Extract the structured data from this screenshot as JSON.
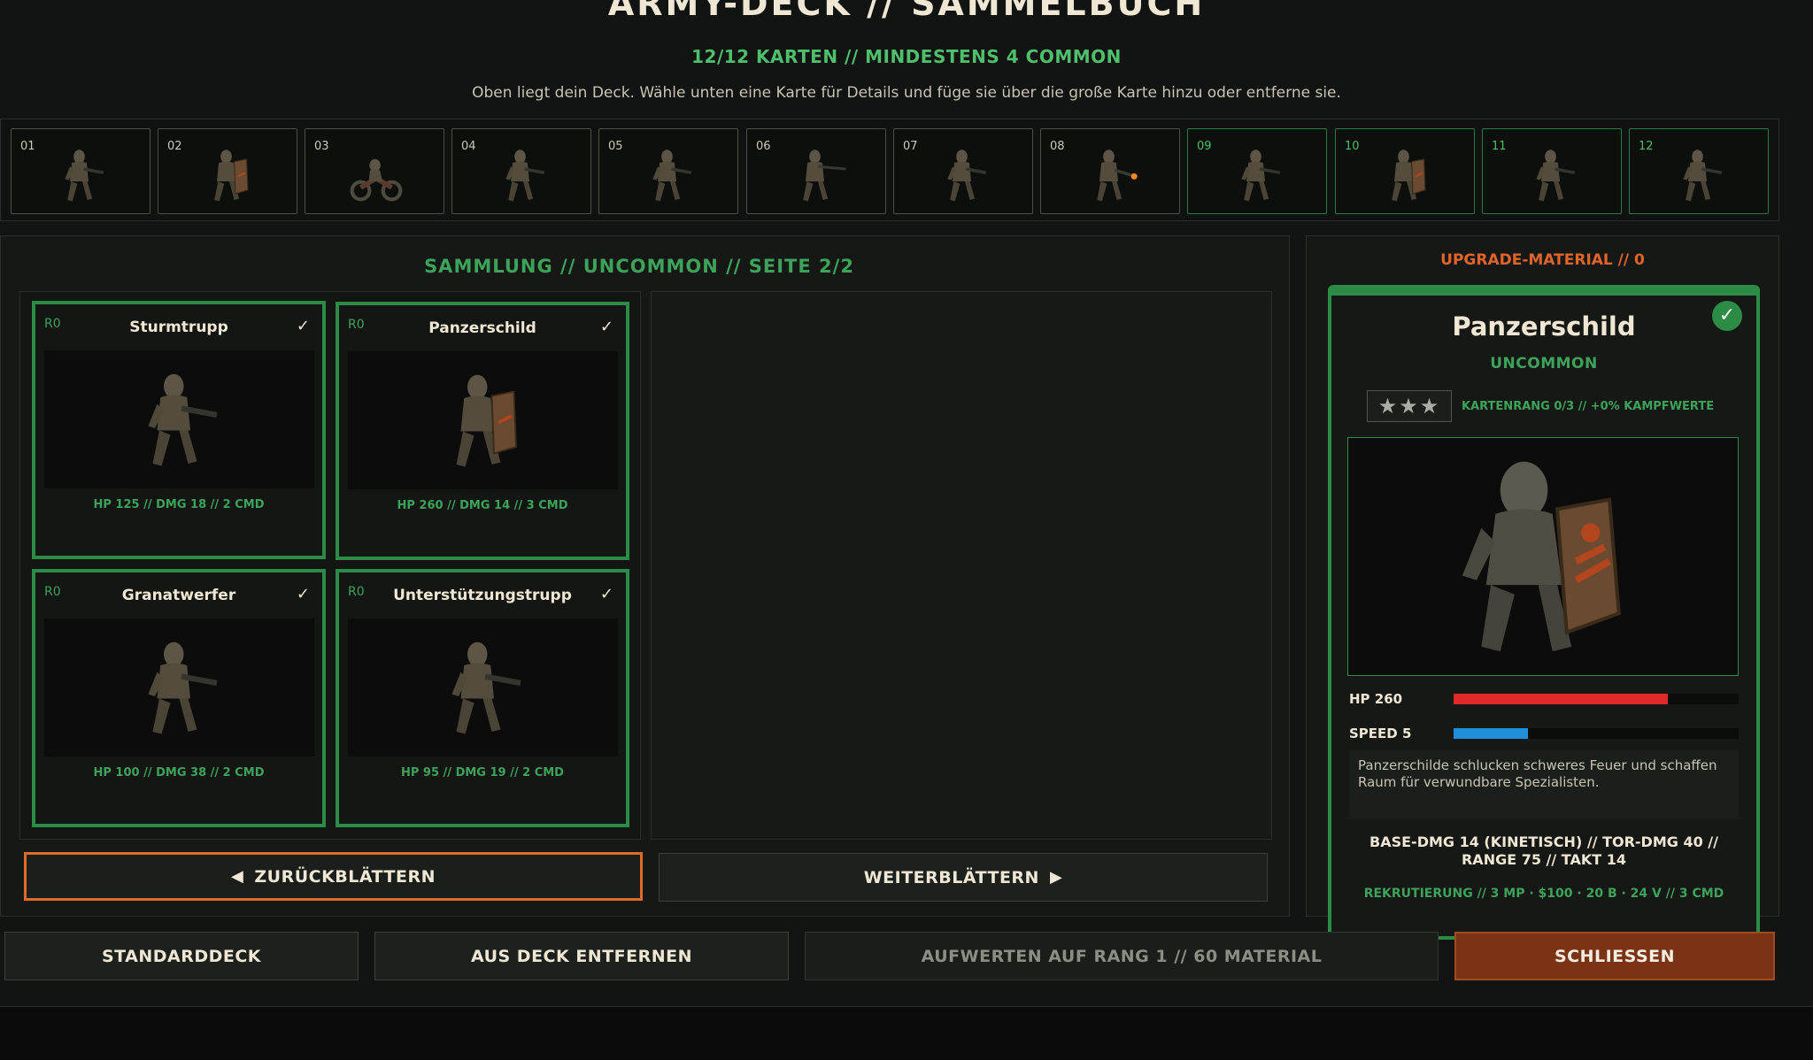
{
  "header": {
    "title": "ARMY-DECK  //  SAMMELBUCH",
    "subtitle": "12/12 KARTEN  //  MINDESTENS 4 COMMON",
    "hint": "Oben liegt dein Deck. Wähle unten eine Karte für Details und füge sie über die große Karte hinzu oder entferne sie."
  },
  "deck": {
    "slots": [
      {
        "num": "01",
        "unit": "rifle-soldier-icon"
      },
      {
        "num": "02",
        "unit": "shield-soldier-icon"
      },
      {
        "num": "03",
        "unit": "motorbike-icon"
      },
      {
        "num": "04",
        "unit": "rifle-soldier-icon"
      },
      {
        "num": "05",
        "unit": "rifle-soldier-icon"
      },
      {
        "num": "06",
        "unit": "sniper-icon"
      },
      {
        "num": "07",
        "unit": "scout-icon"
      },
      {
        "num": "08",
        "unit": "flamethrower-icon"
      },
      {
        "num": "09",
        "unit": "grenadier-icon"
      },
      {
        "num": "10",
        "unit": "shield-soldier-icon"
      },
      {
        "num": "11",
        "unit": "grenadier-icon"
      },
      {
        "num": "12",
        "unit": "support-gunner-icon"
      }
    ]
  },
  "collection": {
    "title": "SAMMLUNG  //  UNCOMMON  //  SEITE 2/2",
    "cards": [
      {
        "rank": "R0",
        "name": "Sturmtrupp",
        "check": "✓",
        "stats": "HP 125  //  DMG 18  //  2 CMD",
        "selected": false
      },
      {
        "rank": "R0",
        "name": "Panzerschild",
        "check": "✓",
        "stats": "HP 260  //  DMG 14  //  3 CMD",
        "selected": true
      },
      {
        "rank": "R0",
        "name": "Granatwerfer",
        "check": "✓",
        "stats": "HP 100  //  DMG 38  //  2 CMD",
        "selected": false
      },
      {
        "rank": "R0",
        "name": "Unterstützungstrupp",
        "check": "✓",
        "stats": "HP 95  //  DMG 19  //  2 CMD",
        "selected": false
      }
    ],
    "prev_label": "ZURÜCKBLÄTTERN",
    "next_label": "WEITERBLÄTTERN"
  },
  "detail": {
    "upgrade_material": "UPGRADE-MATERIAL  //  0",
    "name": "Panzerschild",
    "rarity": "UNCOMMON",
    "stars": "★★★",
    "rank_text": "KARTENRANG 0/3  //  +0% KAMPFWERTE",
    "check": "✓",
    "hp_label": "HP  260",
    "hp_fraction": 0.75,
    "speed_label": "SPEED  5",
    "speed_fraction": 0.26,
    "description": "Panzerschilde schlucken schweres Feuer und schaffen Raum für verwundbare Spezialisten.",
    "combat": "BASE-DMG 14 (KINETISCH)  //  TOR-DMG 40  //  RANGE 75  //  TAKT 14",
    "recruit": "REKRUTIERUNG  //  3 MP · $100 · 20 B · 24 V  //  3 CMD"
  },
  "actions": {
    "standard_deck": "STANDARDDECK",
    "remove": "AUS DECK ENTFERNEN",
    "upgrade": "AUFWERTEN AUF RANG 1  //  60 MATERIAL",
    "close": "SCHLIESSEN"
  },
  "colors": {
    "accent_green": "#2c8c45",
    "accent_orange": "#e06a2a",
    "hp_bar": "#e02a2a",
    "speed_bar": "#1e8fd8"
  }
}
